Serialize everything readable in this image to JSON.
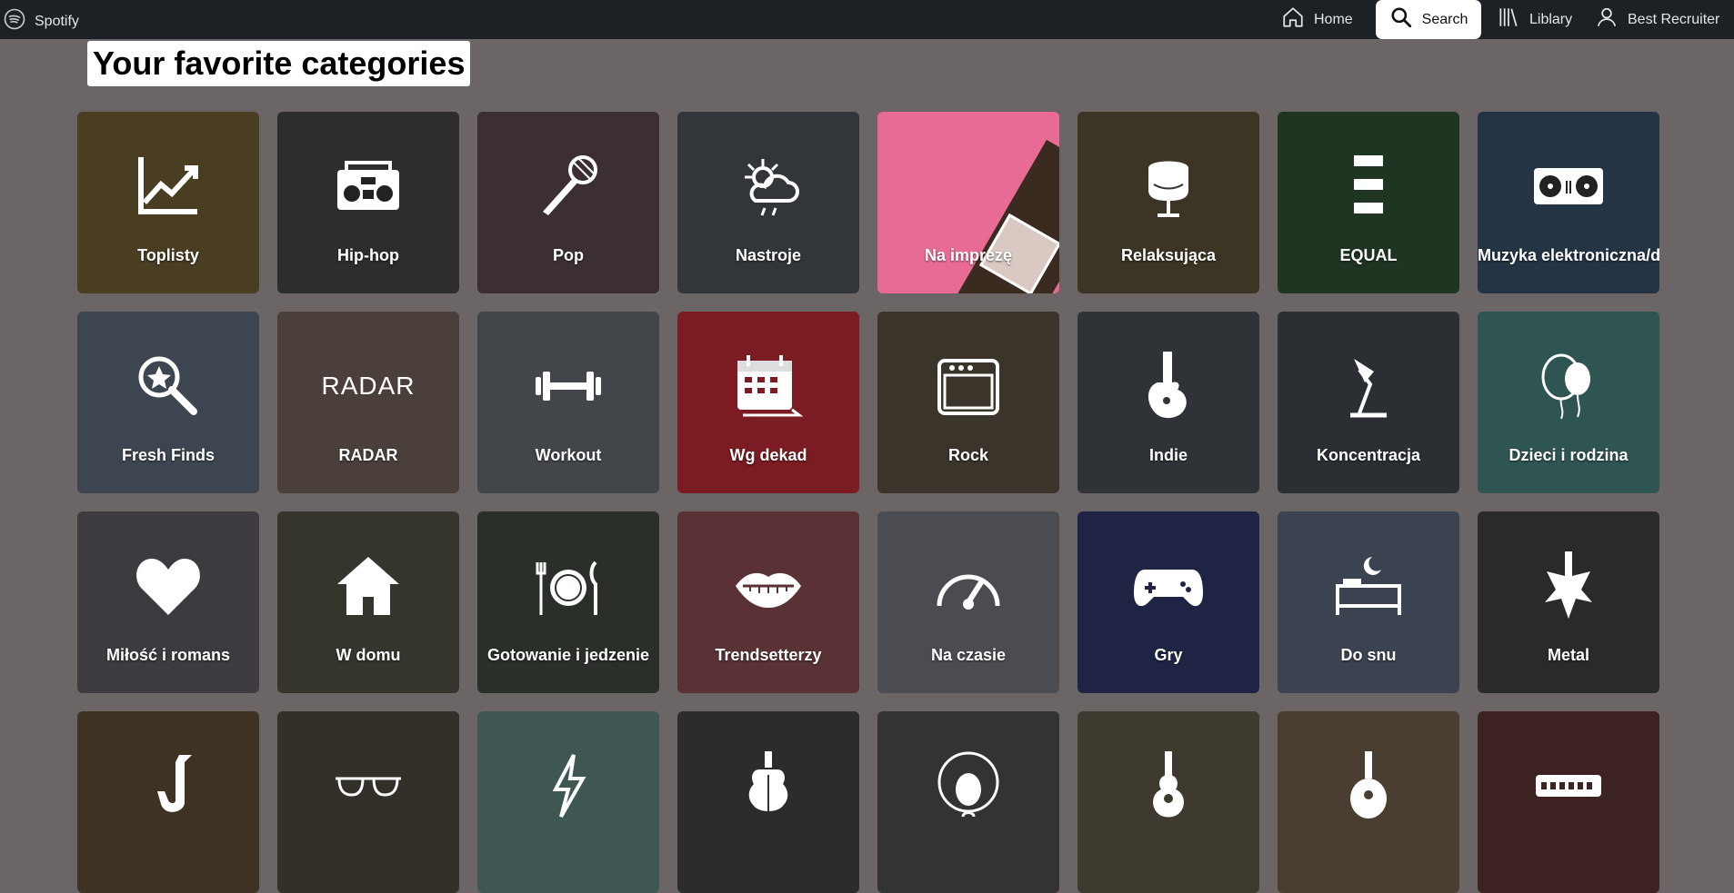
{
  "header": {
    "brand": "Spotify",
    "nav": {
      "home": "Home",
      "search": "Search",
      "library": "Liblary",
      "user": "Best Recruiter"
    }
  },
  "page_title": "Your favorite categories",
  "colors": {
    "topbar": "#1c2126",
    "page_bg": "#6b6566",
    "active_nav_bg": "#ffffff"
  },
  "categories": [
    {
      "label": "Toplisty",
      "icon": "chart-up-icon",
      "bg": "#4a3e22"
    },
    {
      "label": "Hip-hop",
      "icon": "boombox-icon",
      "bg": "#2d2d2d"
    },
    {
      "label": "Pop",
      "icon": "microphone-icon",
      "bg": "#3b2f33"
    },
    {
      "label": "Nastroje",
      "icon": "weather-icon",
      "bg": "#32363a"
    },
    {
      "label": "Na imprezę",
      "icon": "",
      "bg": "#e86b96"
    },
    {
      "label": "Relaksująca",
      "icon": "egg-chair-icon",
      "bg": "#3c3424"
    },
    {
      "label": "EQUAL",
      "icon": "equal-bars-icon",
      "bg": "#1f3522"
    },
    {
      "label": "Muzyka elektroniczna/dance",
      "icon": "turntable-icon",
      "bg": "#243444"
    },
    {
      "label": "Fresh Finds",
      "icon": "magnifier-star-icon",
      "bg": "#3d4650"
    },
    {
      "label": "RADAR",
      "icon": "radar-wordmark",
      "bg": "#4b3f3c"
    },
    {
      "label": "Workout",
      "icon": "dumbbell-icon",
      "bg": "#424549"
    },
    {
      "label": "Wg dekad",
      "icon": "calendar-icon",
      "bg": "#7a1c22"
    },
    {
      "label": "Rock",
      "icon": "amplifier-icon",
      "bg": "#3a342a"
    },
    {
      "label": "Indie",
      "icon": "electric-guitar-icon",
      "bg": "#2f3338"
    },
    {
      "label": "Koncentracja",
      "icon": "desk-lamp-icon",
      "bg": "#2b2f34"
    },
    {
      "label": "Dzieci i rodzina",
      "icon": "balloon-icon",
      "bg": "#2f5553"
    },
    {
      "label": "Miłość i romans",
      "icon": "heart-icon",
      "bg": "#3d3b3f"
    },
    {
      "label": "W domu",
      "icon": "house-icon",
      "bg": "#35352d"
    },
    {
      "label": "Gotowanie i jedzenie",
      "icon": "plate-cutlery-icon",
      "bg": "#2b2f2a"
    },
    {
      "label": "Trendsetterzy",
      "icon": "lips-icon",
      "bg": "#5a3236"
    },
    {
      "label": "Na czasie",
      "icon": "speedometer-icon",
      "bg": "#4b4c52"
    },
    {
      "label": "Gry",
      "icon": "gamepad-icon",
      "bg": "#1f2444"
    },
    {
      "label": "Do snu",
      "icon": "bed-moon-icon",
      "bg": "#3b4250"
    },
    {
      "label": "Metal",
      "icon": "metal-guitar-icon",
      "bg": "#2a2a2a"
    },
    {
      "label": "",
      "icon": "saxophone-icon",
      "bg": "#3e3223"
    },
    {
      "label": "",
      "icon": "sunglasses-icon",
      "bg": "#33302a"
    },
    {
      "label": "",
      "icon": "lightning-face-icon",
      "bg": "#3f5753"
    },
    {
      "label": "",
      "icon": "violin-icon",
      "bg": "#2c2c2c"
    },
    {
      "label": "",
      "icon": "afro-icon",
      "bg": "#333333"
    },
    {
      "label": "",
      "icon": "acoustic-guitar-icon",
      "bg": "#3e3a2f"
    },
    {
      "label": "",
      "icon": "mandolin-icon",
      "bg": "#4a3e30"
    },
    {
      "label": "",
      "icon": "harmonica-icon",
      "bg": "#3d2222"
    }
  ]
}
